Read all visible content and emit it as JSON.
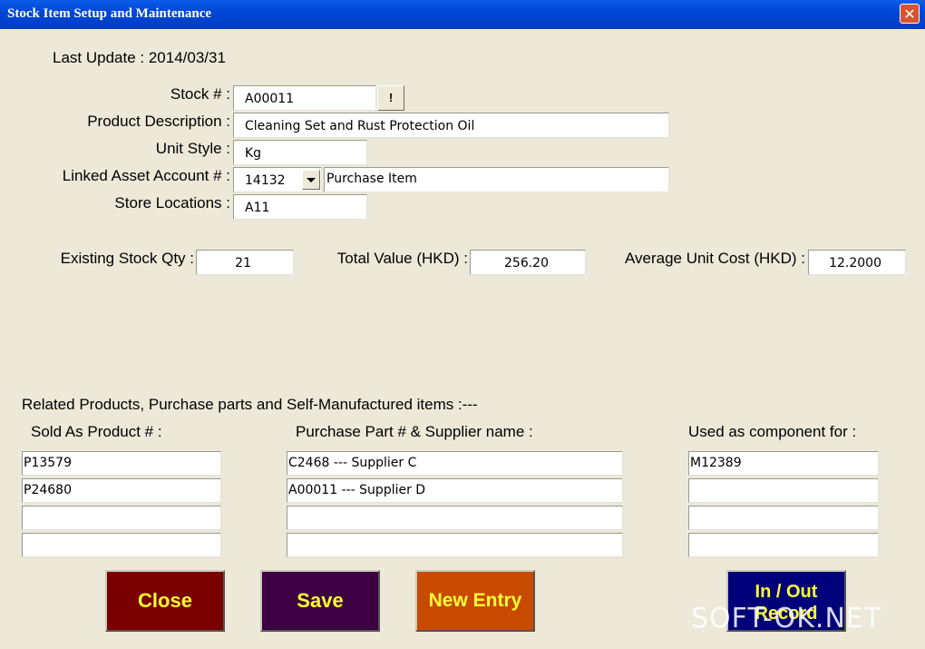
{
  "window": {
    "title": "Stock Item Setup and Maintenance"
  },
  "icons": {
    "close": "close-icon",
    "dropdown": "chevron-down-icon"
  },
  "header": {
    "last_update": "Last Update : 2014/03/31"
  },
  "form": {
    "stock_label": "Stock # :",
    "stock_value": "A00011",
    "stock_lookup_label": "!",
    "product_desc_label": "Product Description :",
    "product_desc_value": "Cleaning Set and Rust Protection Oil",
    "unit_style_label": "Unit Style :",
    "unit_style_value": "Kg",
    "linked_asset_label": "Linked Asset Account # :",
    "linked_asset_value": "14132",
    "linked_asset_name": "Purchase Item",
    "store_locations_label": "Store Locations :",
    "store_locations_value": "A11"
  },
  "stats": {
    "existing_qty_label": "Existing Stock Qty :",
    "existing_qty_value": "21",
    "total_value_label": "Total Value (HKD) :",
    "total_value_value": "256.20",
    "avg_cost_label": "Average Unit Cost (HKD) :",
    "avg_cost_value": "12.2000"
  },
  "related": {
    "heading": "Related Products, Purchase parts and Self-Manufactured items :---",
    "sold_as_label": "Sold As Product # :",
    "sold_as": [
      "P13579",
      "P24680",
      "",
      ""
    ],
    "purchase_part_label": "Purchase Part # & Supplier name :",
    "purchase_parts": [
      "C2468 --- Supplier C",
      "A00011 --- Supplier D",
      "",
      ""
    ],
    "component_label": "Used as component for :",
    "components": [
      "M12389",
      "",
      "",
      ""
    ]
  },
  "buttons": {
    "close": "Close",
    "save": "Save",
    "new_entry": "New Entry",
    "in_out_line1": "In / Out",
    "in_out_line2": "Record"
  },
  "colors": {
    "close_btn": "#7a0000",
    "save_btn": "#3d0042",
    "new_entry_btn": "#c84a00",
    "in_out_btn": "#00007a",
    "button_text": "#ffff33",
    "titlebar": "#0a5ee8"
  },
  "watermark": "SOFT-OK.NET"
}
